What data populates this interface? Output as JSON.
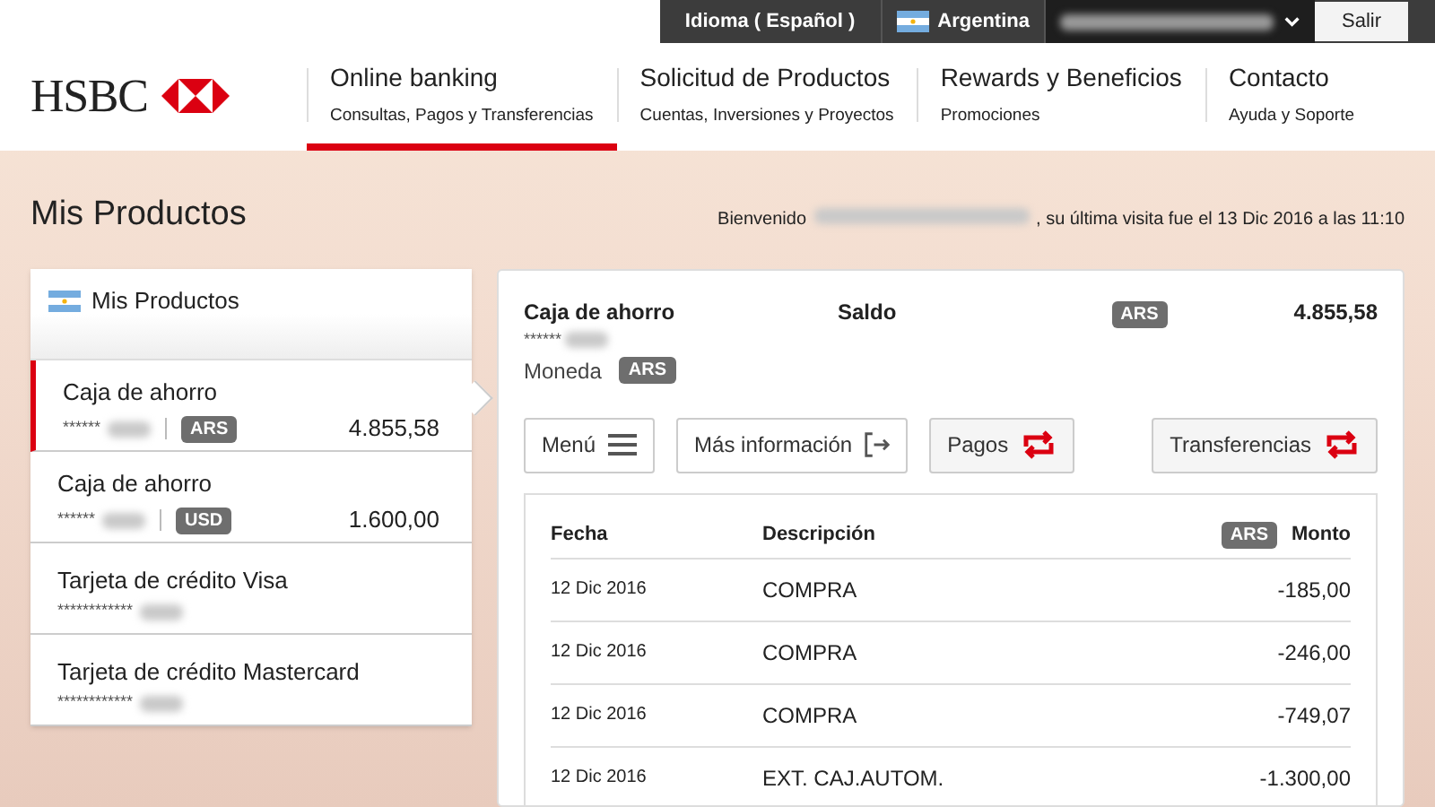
{
  "top_bar": {
    "language": "Idioma ( Español )",
    "country": "Argentina",
    "logout": "Salir"
  },
  "header": {
    "logo": "HSBC",
    "nav": [
      {
        "title": "Online banking",
        "subtitle": "Consultas, Pagos y Transferencias",
        "selected": true
      },
      {
        "title": "Solicitud de Productos",
        "subtitle": "Cuentas, Inversiones y Proyectos",
        "selected": false
      },
      {
        "title": "Rewards y Beneficios",
        "subtitle": "Promociones",
        "selected": false
      },
      {
        "title": "Contacto",
        "subtitle": "Ayuda y Soporte",
        "selected": false
      }
    ]
  },
  "page": {
    "title": "Mis Productos",
    "welcome": "Bienvenido",
    "last_visit": ", su última visita fue el 13 Dic 2016 a las 11:10"
  },
  "sidebar": {
    "title": "Mis Productos",
    "items": [
      {
        "name": "Caja de ahorro",
        "masked": "******",
        "currency": "ARS",
        "balance": "4.855,58",
        "selected": true
      },
      {
        "name": "Caja de ahorro",
        "masked": "******",
        "currency": "USD",
        "balance": "1.600,00",
        "selected": false
      },
      {
        "name": "Tarjeta de crédito Visa",
        "masked": "************",
        "selected": false
      },
      {
        "name": "Tarjeta de crédito Mastercard",
        "masked": "************",
        "selected": false
      }
    ]
  },
  "detail": {
    "account": "Caja de ahorro",
    "masked": "******",
    "currency_label": "Moneda",
    "currency": "ARS",
    "balance_label": "Saldo",
    "balance_currency": "ARS",
    "balance": "4.855,58",
    "buttons": [
      {
        "label": "Menú",
        "kind": "menu"
      },
      {
        "label": "Más información",
        "kind": "info"
      },
      {
        "label": "Pagos",
        "kind": "transfer"
      },
      {
        "label": "Transferencias",
        "kind": "transfer"
      }
    ],
    "table": {
      "columns": [
        "Fecha",
        "Descripción",
        "Monto"
      ],
      "currency": "ARS",
      "rows": [
        {
          "date": "12 Dic 2016",
          "description": "COMPRA",
          "amount": "-185,00"
        },
        {
          "date": "12 Dic 2016",
          "description": "COMPRA",
          "amount": "-246,00"
        },
        {
          "date": "12 Dic 2016",
          "description": "COMPRA",
          "amount": "-749,07"
        },
        {
          "date": "12 Dic 2016",
          "description": "EXT. CAJ.AUTOM.",
          "amount": "-1.300,00"
        }
      ]
    }
  }
}
